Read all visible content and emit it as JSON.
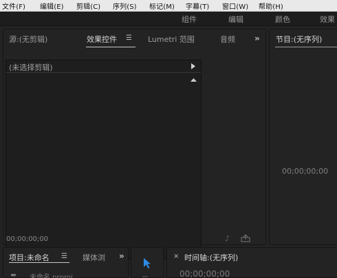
{
  "menu": {
    "items": [
      "文件(F)",
      "编辑(E)",
      "剪辑(C)",
      "序列(S)",
      "标记(M)",
      "字幕(T)",
      "窗口(W)",
      "帮助(H)"
    ]
  },
  "workspaces": [
    "组件",
    "编辑",
    "颜色",
    "效果"
  ],
  "source_panel": {
    "tabs": [
      "源:(无剪辑)",
      "效果控件",
      "Lumetri 范围",
      "音频"
    ],
    "active_tab_menu_icon": "hamburger-menu-icon",
    "overflow_icon": "double-chevron-right-icon",
    "clip_selector": "(未选择剪辑)",
    "timecode": "00;00;00;00",
    "footer_icons": [
      "audio-note-icon",
      "export-icon"
    ]
  },
  "program_panel": {
    "title": "节目:(无序列)",
    "timecode": "00;00;00;00"
  },
  "project_panel": {
    "tabs": [
      "项目:未命名",
      "媒体浏"
    ],
    "item_label": "未命名.prproj"
  },
  "tools_panel": {
    "tool_icon": "selection-arrow-icon"
  },
  "timeline_panel": {
    "title": "时间轴:(无序列)",
    "timecode": "00;00;00;00"
  },
  "colors": {
    "accent_blue": "#2e8ce6",
    "panel_bg": "#232323",
    "menu_bg": "#e9e9e9"
  }
}
